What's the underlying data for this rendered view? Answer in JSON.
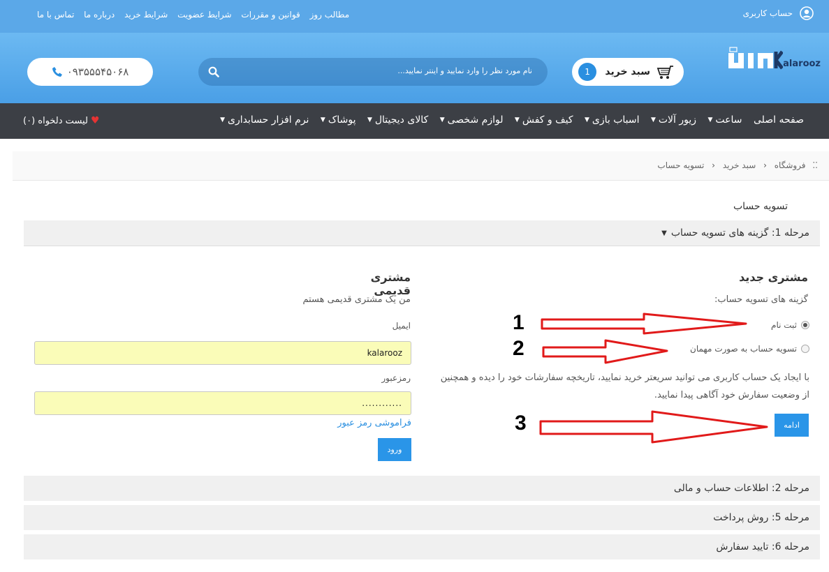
{
  "topbar": {
    "links": [
      "مطالب روز",
      "قوانین و مقررات",
      "شرایط عضویت",
      "شرایط خرید",
      "درباره ما",
      "تماس با ما"
    ],
    "account_label": "حساب کاربری"
  },
  "header": {
    "logo_text": "alarooz",
    "cart_label": "سبد خرید",
    "cart_count": "1",
    "search_placeholder": "نام مورد نظر را وارد نمایید و اینتر نمایید...",
    "phone": "۰۹۳۵۵۵۴۵۰۶۸"
  },
  "nav": {
    "items": [
      "صفحه اصلی",
      "ساعت",
      "زیور آلات",
      "اسباب بازی",
      "کیف و کفش",
      "لوازم شخصی",
      "کالای دیجیتال",
      "پوشاک",
      "نرم افزار حسابداری"
    ],
    "wishlist": "لیست دلخواه (۰)"
  },
  "breadcrumb": [
    "فروشگاه",
    "سبد خرید",
    "تسویه حساب"
  ],
  "page_title": "تسویه حساب",
  "steps": {
    "step1": "مرحله 1: گزینه های تسویه حساب",
    "step2": "مرحله 2: اطلاعات حساب و مالی",
    "step5": "مرحله 5: روش پرداخت",
    "step6": "مرحله 6: تایید سفارش"
  },
  "new_customer": {
    "heading": "مشتری جدید",
    "subheading": "گزینه های تسویه حساب:",
    "option_register": "ثبت نام",
    "option_guest": "تسویه حساب به صورت مهمان",
    "selected": "register",
    "description": "با ایجاد یک حساب کاربری می توانید سریعتر خرید نمایید، تاریخچه سفارشات خود را دیده و همچنین از وضعیت سفارش خود آگاهی پیدا نمایید.",
    "continue_label": "ادامه"
  },
  "returning_customer": {
    "heading": "مشتری قدیمی",
    "subheading": "من یک مشتری قدیمی هستم",
    "email_label": "ایمیل",
    "email_value": "kalarooz",
    "password_label": "رمزعبور",
    "password_value": "............",
    "forgot_label": "فراموشی رمز عبور",
    "login_label": "ورود"
  },
  "annotations": {
    "labels": [
      "1",
      "2",
      "3"
    ],
    "arrow_color": "#e11a1a"
  },
  "colors": {
    "topbar": "#5ba8e8",
    "nav": "#3c3f45",
    "button": "#2a95e8",
    "field_bg": "#fafcb8"
  }
}
